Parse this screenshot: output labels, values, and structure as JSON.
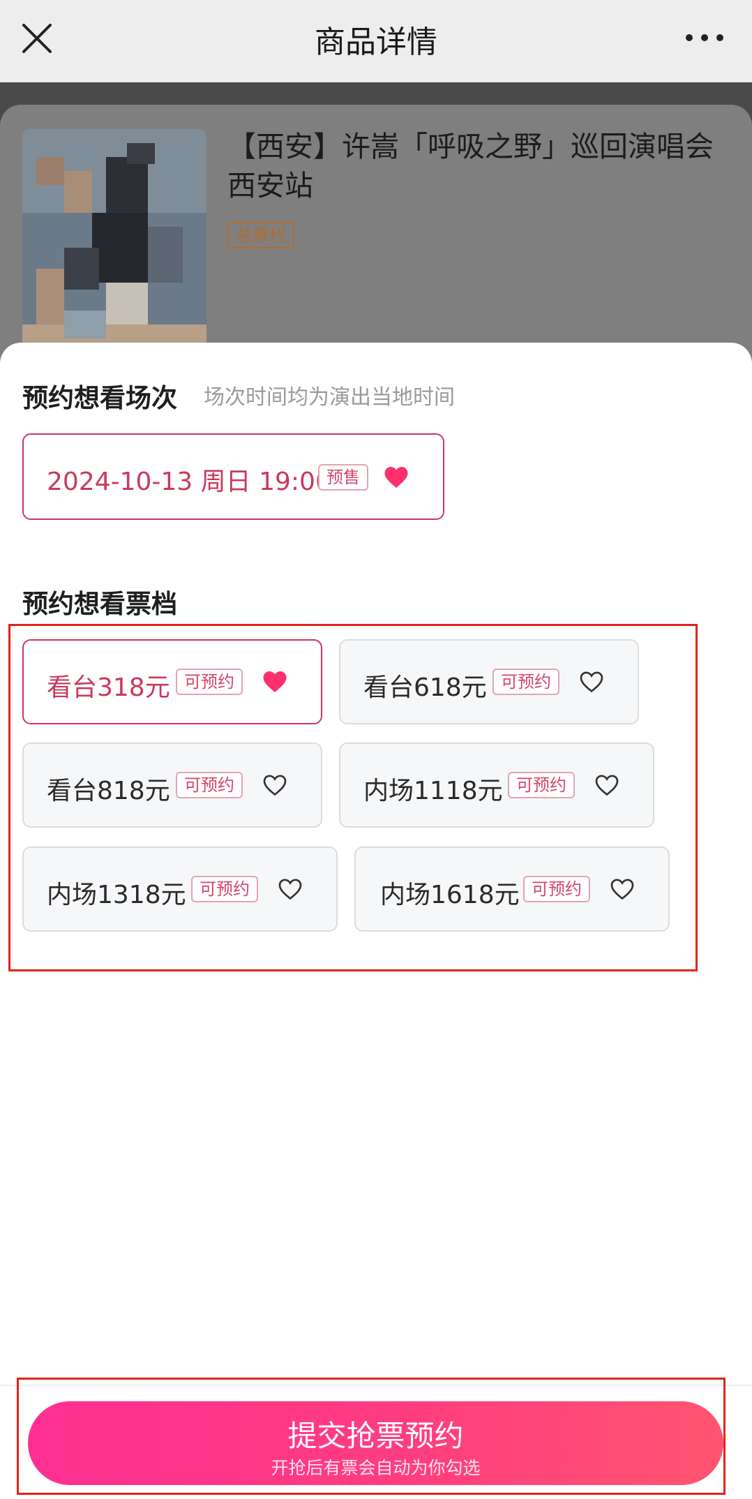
{
  "nav": {
    "title": "商品详情"
  },
  "product": {
    "title": "【西安】许嵩「呼吸之野」巡回演唱会 西安站",
    "badge": "总票代"
  },
  "session_section": {
    "title": "预约想看场次",
    "subtitle": "场次时间均为演出当地时间",
    "sessions": [
      {
        "text": "2024-10-13 周日 19:00",
        "tag": "预售",
        "favorited": true
      }
    ]
  },
  "tier_section": {
    "title": "预约想看票档",
    "tiers": [
      {
        "label": "看台318元",
        "tag": "可预约",
        "selected": true
      },
      {
        "label": "看台618元",
        "tag": "可预约",
        "selected": false
      },
      {
        "label": "看台818元",
        "tag": "可预约",
        "selected": false
      },
      {
        "label": "内场1118元",
        "tag": "可预约",
        "selected": false
      },
      {
        "label": "内场1318元",
        "tag": "可预约",
        "selected": false
      },
      {
        "label": "内场1618元",
        "tag": "可预约",
        "selected": false
      }
    ]
  },
  "submit": {
    "label": "提交抢票预约",
    "sublabel": "开抢后有票会自动为你勾选"
  },
  "colors": {
    "accent": "#c9395d",
    "button_gradient_start": "#ff2f92",
    "button_gradient_end": "#ff5470",
    "highlight_frame": "#e2231a"
  },
  "icons": {
    "close": "close-icon",
    "more": "more-dots-icon",
    "heart_filled": "heart-filled-icon",
    "heart_outline": "heart-outline-icon"
  }
}
